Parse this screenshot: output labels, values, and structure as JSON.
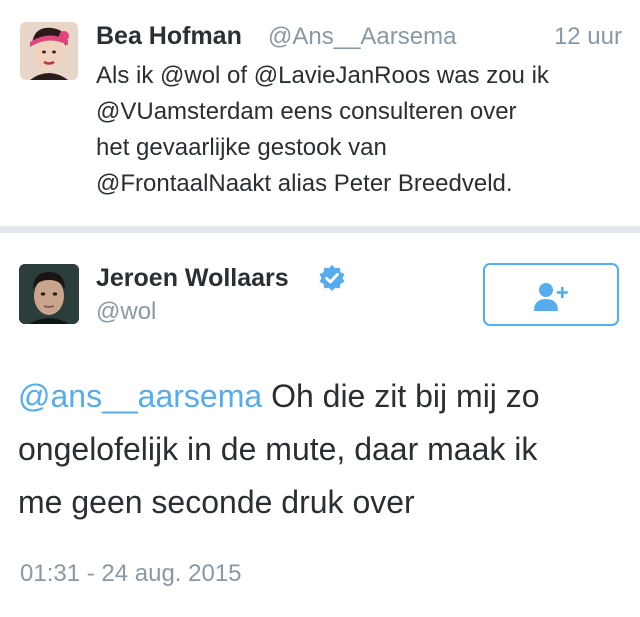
{
  "reply_tweet": {
    "author_name": "Bea Hofman",
    "author_handle": "@Ans__Aarsema",
    "time": "12 uur",
    "text_lines": [
      "Als ik @wol of @LavieJanRoos was zou ik",
      "@VUamsterdam eens consulteren over",
      "het gevaarlijke gestook van",
      "@FrontaalNaakt alias Peter Breedveld."
    ]
  },
  "main_tweet": {
    "author_name": "Jeroen Wollaars",
    "verified_icon": "verified-badge-icon",
    "author_handle": "@wol",
    "follow_button_icon": "add-user-icon",
    "mention": "@ans__aarsema",
    "text_first_line_rest": " Oh die zit bij mij zo",
    "text_lines": [
      "ongelofelijk in de mute, daar maak ik",
      "me geen seconde druk over"
    ],
    "timestamp": "01:31 - 24 aug. 2015"
  },
  "colors": {
    "link": "#55acee",
    "secondary_text": "#8899a6",
    "primary_text": "#292f33",
    "divider": "#e1e8ed"
  }
}
